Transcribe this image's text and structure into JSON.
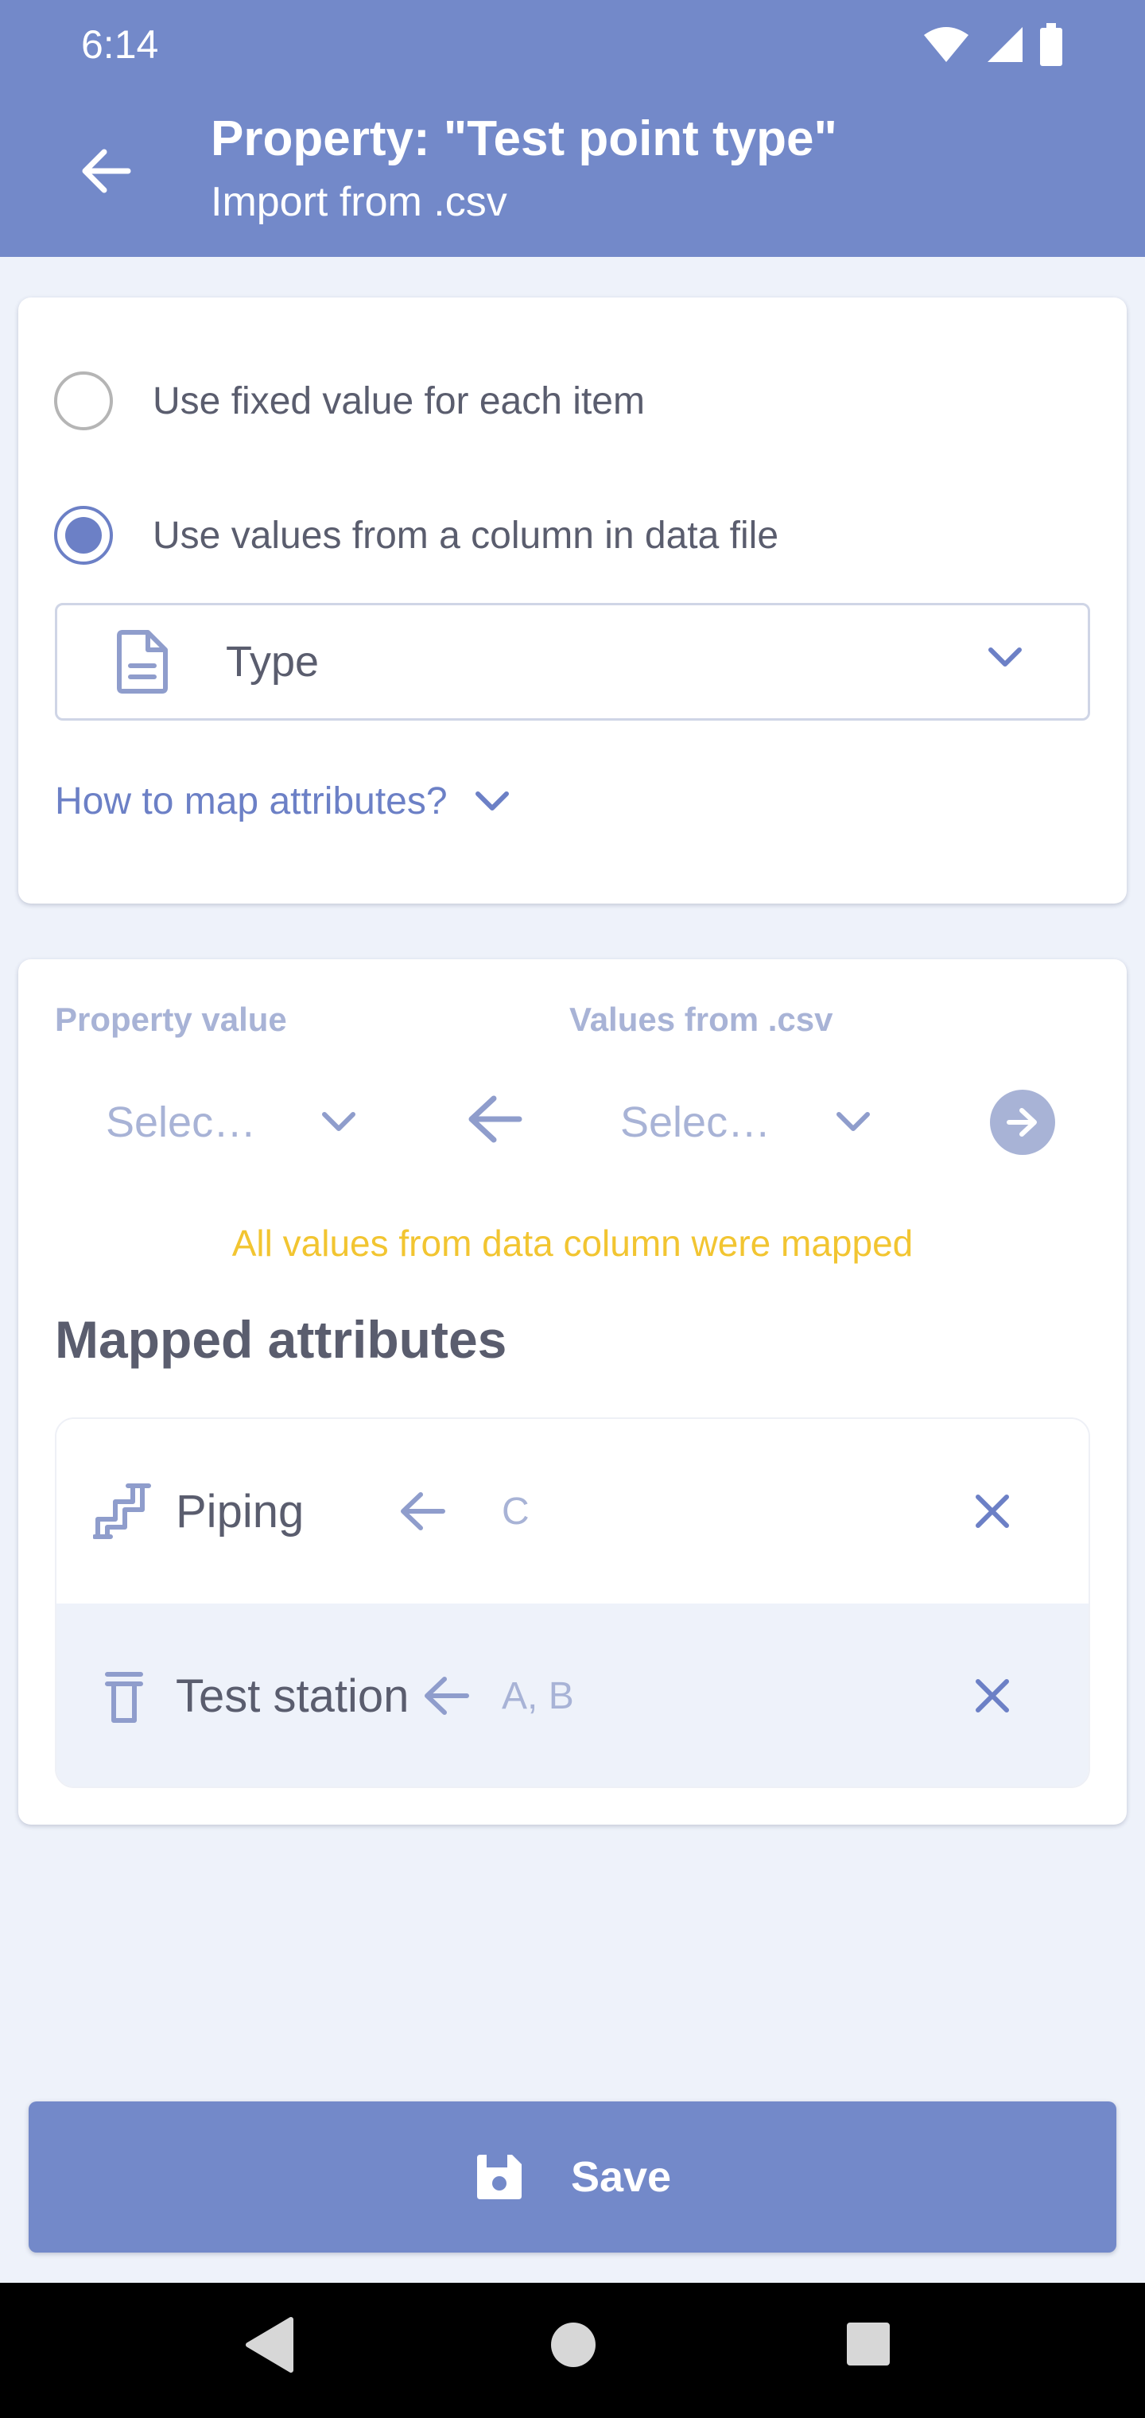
{
  "status_bar": {
    "time": "6:14",
    "icons": [
      "wifi-icon",
      "signal-icon",
      "battery-icon"
    ]
  },
  "header": {
    "back_icon": "arrow-left-icon",
    "title": "Property: \"Test point type\"",
    "subtitle": "Import from .csv"
  },
  "source_options": {
    "fixed_label": "Use fixed value for each item",
    "fixed_checked": false,
    "column_label": "Use values from a column in data file",
    "column_checked": true
  },
  "column_select": {
    "icon": "file-document-icon",
    "value": "Type"
  },
  "help_link": {
    "label": "How to map attributes?"
  },
  "mapping_form": {
    "property_label": "Property value",
    "csv_label": "Values from .csv",
    "property_placeholder": "Selec…",
    "csv_placeholder": "Selec…",
    "notice": "All values from data column were mapped"
  },
  "mapped": {
    "title": "Mapped attributes",
    "rows": [
      {
        "icon": "piping-icon",
        "name": "Piping",
        "value": "C"
      },
      {
        "icon": "test-station-icon",
        "name": "Test station",
        "value": "A, B"
      }
    ]
  },
  "save_button": {
    "label": "Save",
    "icon": "save-icon"
  },
  "colors": {
    "primary": "#7389c9",
    "accent": "#6c80c6",
    "muted": "#a8b3d6",
    "warning": "#f2c531",
    "background": "#eef2fa",
    "text": "#5a5d6e"
  }
}
